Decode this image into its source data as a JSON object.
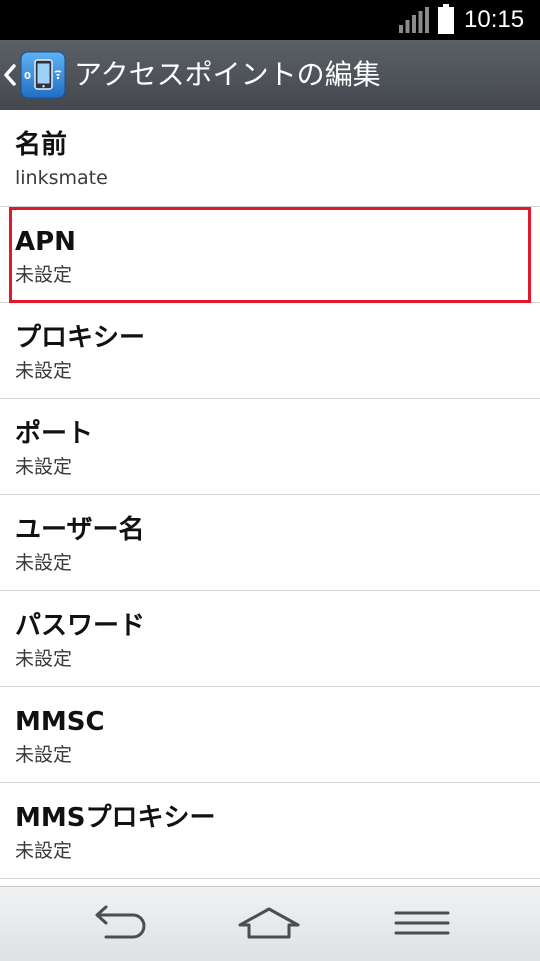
{
  "status_bar": {
    "time": "10:15",
    "icons": [
      "signal-icon",
      "battery-icon"
    ]
  },
  "action_bar": {
    "title": "アクセスポイントの編集",
    "icons": [
      "back-chevron-icon",
      "apn-settings-app-icon"
    ]
  },
  "preferences": [
    {
      "title": "名前",
      "summary": "linksmate"
    },
    {
      "title": "APN",
      "summary": "未設定"
    },
    {
      "title": "プロキシー",
      "summary": "未設定"
    },
    {
      "title": "ポート",
      "summary": "未設定"
    },
    {
      "title": "ユーザー名",
      "summary": "未設定"
    },
    {
      "title": "パスワード",
      "summary": "未設定"
    },
    {
      "title": "MMSC",
      "summary": "未設定"
    },
    {
      "title": "MMSプロキシー",
      "summary": "未設定"
    }
  ],
  "highlight": {
    "target": "APN",
    "color": "#e01a2b"
  },
  "nav_bar": {
    "icons": [
      "back-arrow-icon",
      "home-icon",
      "menu-icon"
    ]
  }
}
